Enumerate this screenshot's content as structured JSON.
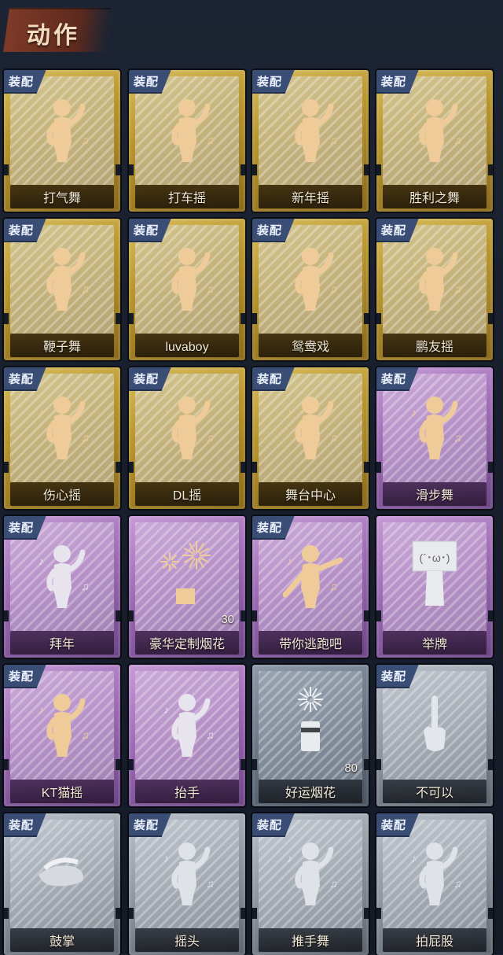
{
  "header": {
    "title": "动作"
  },
  "badge_text": "装配",
  "cards": [
    {
      "name": "打气舞",
      "tier": "gold",
      "equipped": true,
      "icon": "dance-figure-icon"
    },
    {
      "name": "打车摇",
      "tier": "gold",
      "equipped": true,
      "icon": "dance-figure-icon"
    },
    {
      "name": "新年摇",
      "tier": "gold",
      "equipped": true,
      "icon": "dance-figure-icon"
    },
    {
      "name": "胜利之舞",
      "tier": "gold",
      "equipped": true,
      "icon": "dance-figure-icon"
    },
    {
      "name": "鞭子舞",
      "tier": "gold",
      "equipped": true,
      "icon": "dance-figure-icon"
    },
    {
      "name": "luvaboy",
      "tier": "gold",
      "equipped": true,
      "icon": "dance-figure-icon"
    },
    {
      "name": "鸳鸯戏",
      "tier": "gold",
      "equipped": true,
      "icon": "dance-figure-icon"
    },
    {
      "name": "鹏友摇",
      "tier": "gold",
      "equipped": true,
      "icon": "dance-figure-icon"
    },
    {
      "name": "伤心摇",
      "tier": "gold",
      "equipped": true,
      "icon": "heart-hands-figure-icon"
    },
    {
      "name": "DL摇",
      "tier": "gold",
      "equipped": true,
      "icon": "dance-figure-icon"
    },
    {
      "name": "舞台中心",
      "tier": "gold",
      "equipped": true,
      "icon": "dance-figure-icon"
    },
    {
      "name": "滑步舞",
      "tier": "purple",
      "equipped": true,
      "icon": "dance-figure-icon"
    },
    {
      "name": "拜年",
      "tier": "purple",
      "equipped": true,
      "icon": "bow-figure-icon"
    },
    {
      "name": "豪华定制烟花",
      "tier": "purple",
      "equipped": false,
      "icon": "fireworks-box-icon",
      "count": "30"
    },
    {
      "name": "带你逃跑吧",
      "tier": "purple",
      "equipped": true,
      "icon": "point-figure-icon"
    },
    {
      "name": "举牌",
      "tier": "purple",
      "equipped": false,
      "icon": "sign-board-icon"
    },
    {
      "name": "KT猫摇",
      "tier": "purple",
      "equipped": true,
      "icon": "dance-figure-icon"
    },
    {
      "name": "抬手",
      "tier": "purple",
      "equipped": false,
      "icon": "raise-hand-figure-icon"
    },
    {
      "name": "好运烟花",
      "tier": "slate",
      "equipped": false,
      "icon": "firework-can-icon",
      "count": "80"
    },
    {
      "name": "不可以",
      "tier": "grey",
      "equipped": true,
      "icon": "finger-wag-icon"
    },
    {
      "name": "鼓掌",
      "tier": "grey",
      "equipped": true,
      "icon": "clap-hands-icon"
    },
    {
      "name": "摇头",
      "tier": "grey",
      "equipped": true,
      "icon": "shake-head-figure-icon"
    },
    {
      "name": "推手舞",
      "tier": "grey",
      "equipped": true,
      "icon": "push-hands-figure-icon"
    },
    {
      "name": "拍屁股",
      "tier": "grey",
      "equipped": true,
      "icon": "pat-figure-icon"
    }
  ]
}
